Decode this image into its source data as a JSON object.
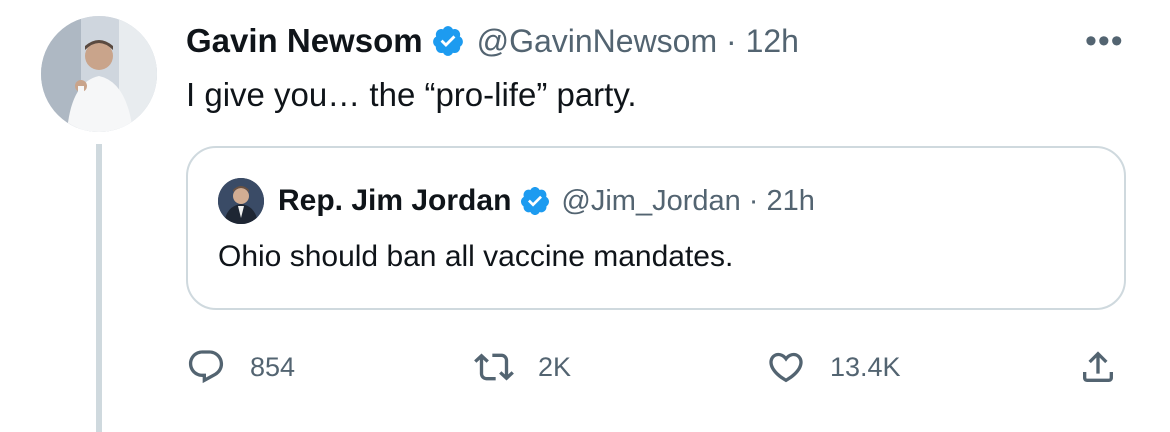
{
  "tweet": {
    "author_name": "Gavin Newsom",
    "handle_line": "@GavinNewsom · 12h",
    "text": "I give you… the “pro-life” party.",
    "more_icon": "•••",
    "icons": {
      "avatar": "avatar",
      "verified": "verified-badge-icon",
      "more": "more-icon"
    }
  },
  "quoted": {
    "author_name": "Rep. Jim Jordan",
    "handle_line": "@Jim_Jordan · 21h",
    "text": "Ohio should ban all vaccine mandates."
  },
  "actions": {
    "reply": {
      "count": "854",
      "icon": "reply-icon"
    },
    "retweet": {
      "count": "2K",
      "icon": "retweet-icon"
    },
    "like": {
      "count": "13.4K",
      "icon": "heart-icon"
    },
    "share": {
      "icon": "share-icon"
    }
  },
  "colors": {
    "text": "#0f1419",
    "secondary": "#536471",
    "verified": "#1d9bf0",
    "border": "#cfd9de"
  }
}
